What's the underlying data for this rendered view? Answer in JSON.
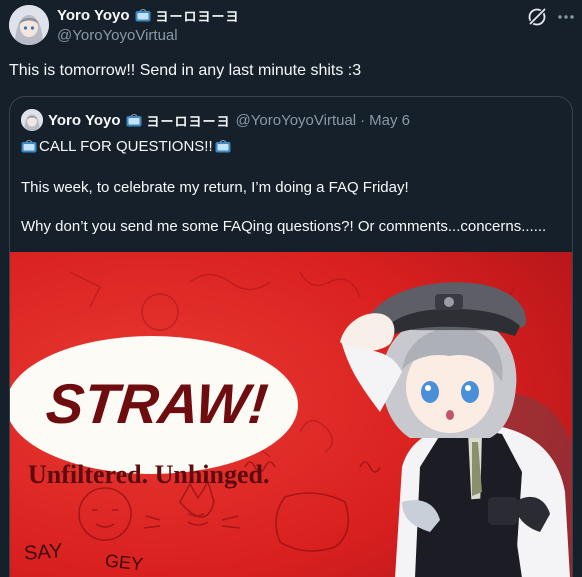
{
  "author": {
    "display_name": "Yoro Yoyo",
    "jp_name": "ヨーロヨーヨ",
    "handle": "@YoroYoyoVirtual"
  },
  "tweet": {
    "text": "This is tomorrow!! Send in any last minute shits :3"
  },
  "quote": {
    "display_name": "Yoro Yoyo",
    "jp_name": "ヨーロヨーヨ",
    "handle": "@YoroYoyoVirtual",
    "separator": "·",
    "date": "May 6",
    "line1": "CALL FOR QUESTIONS!!",
    "line2": "This week, to celebrate my return, I’m doing a FAQ Friday!",
    "line3": "Why don’t you send me some FAQing questions?! Or comments...concerns......"
  },
  "media": {
    "logo_text": "STRAW!",
    "tagline": "Unfiltered. Unhinged.",
    "doodle_say": "SAY",
    "doodle_gey": "GEY",
    "colors": {
      "bg": "#e02421",
      "dark_red": "#8e1013",
      "ellipse": "#fdfbf6"
    }
  },
  "icons": [
    "tv-emoji",
    "grok-icon",
    "more-icon"
  ]
}
